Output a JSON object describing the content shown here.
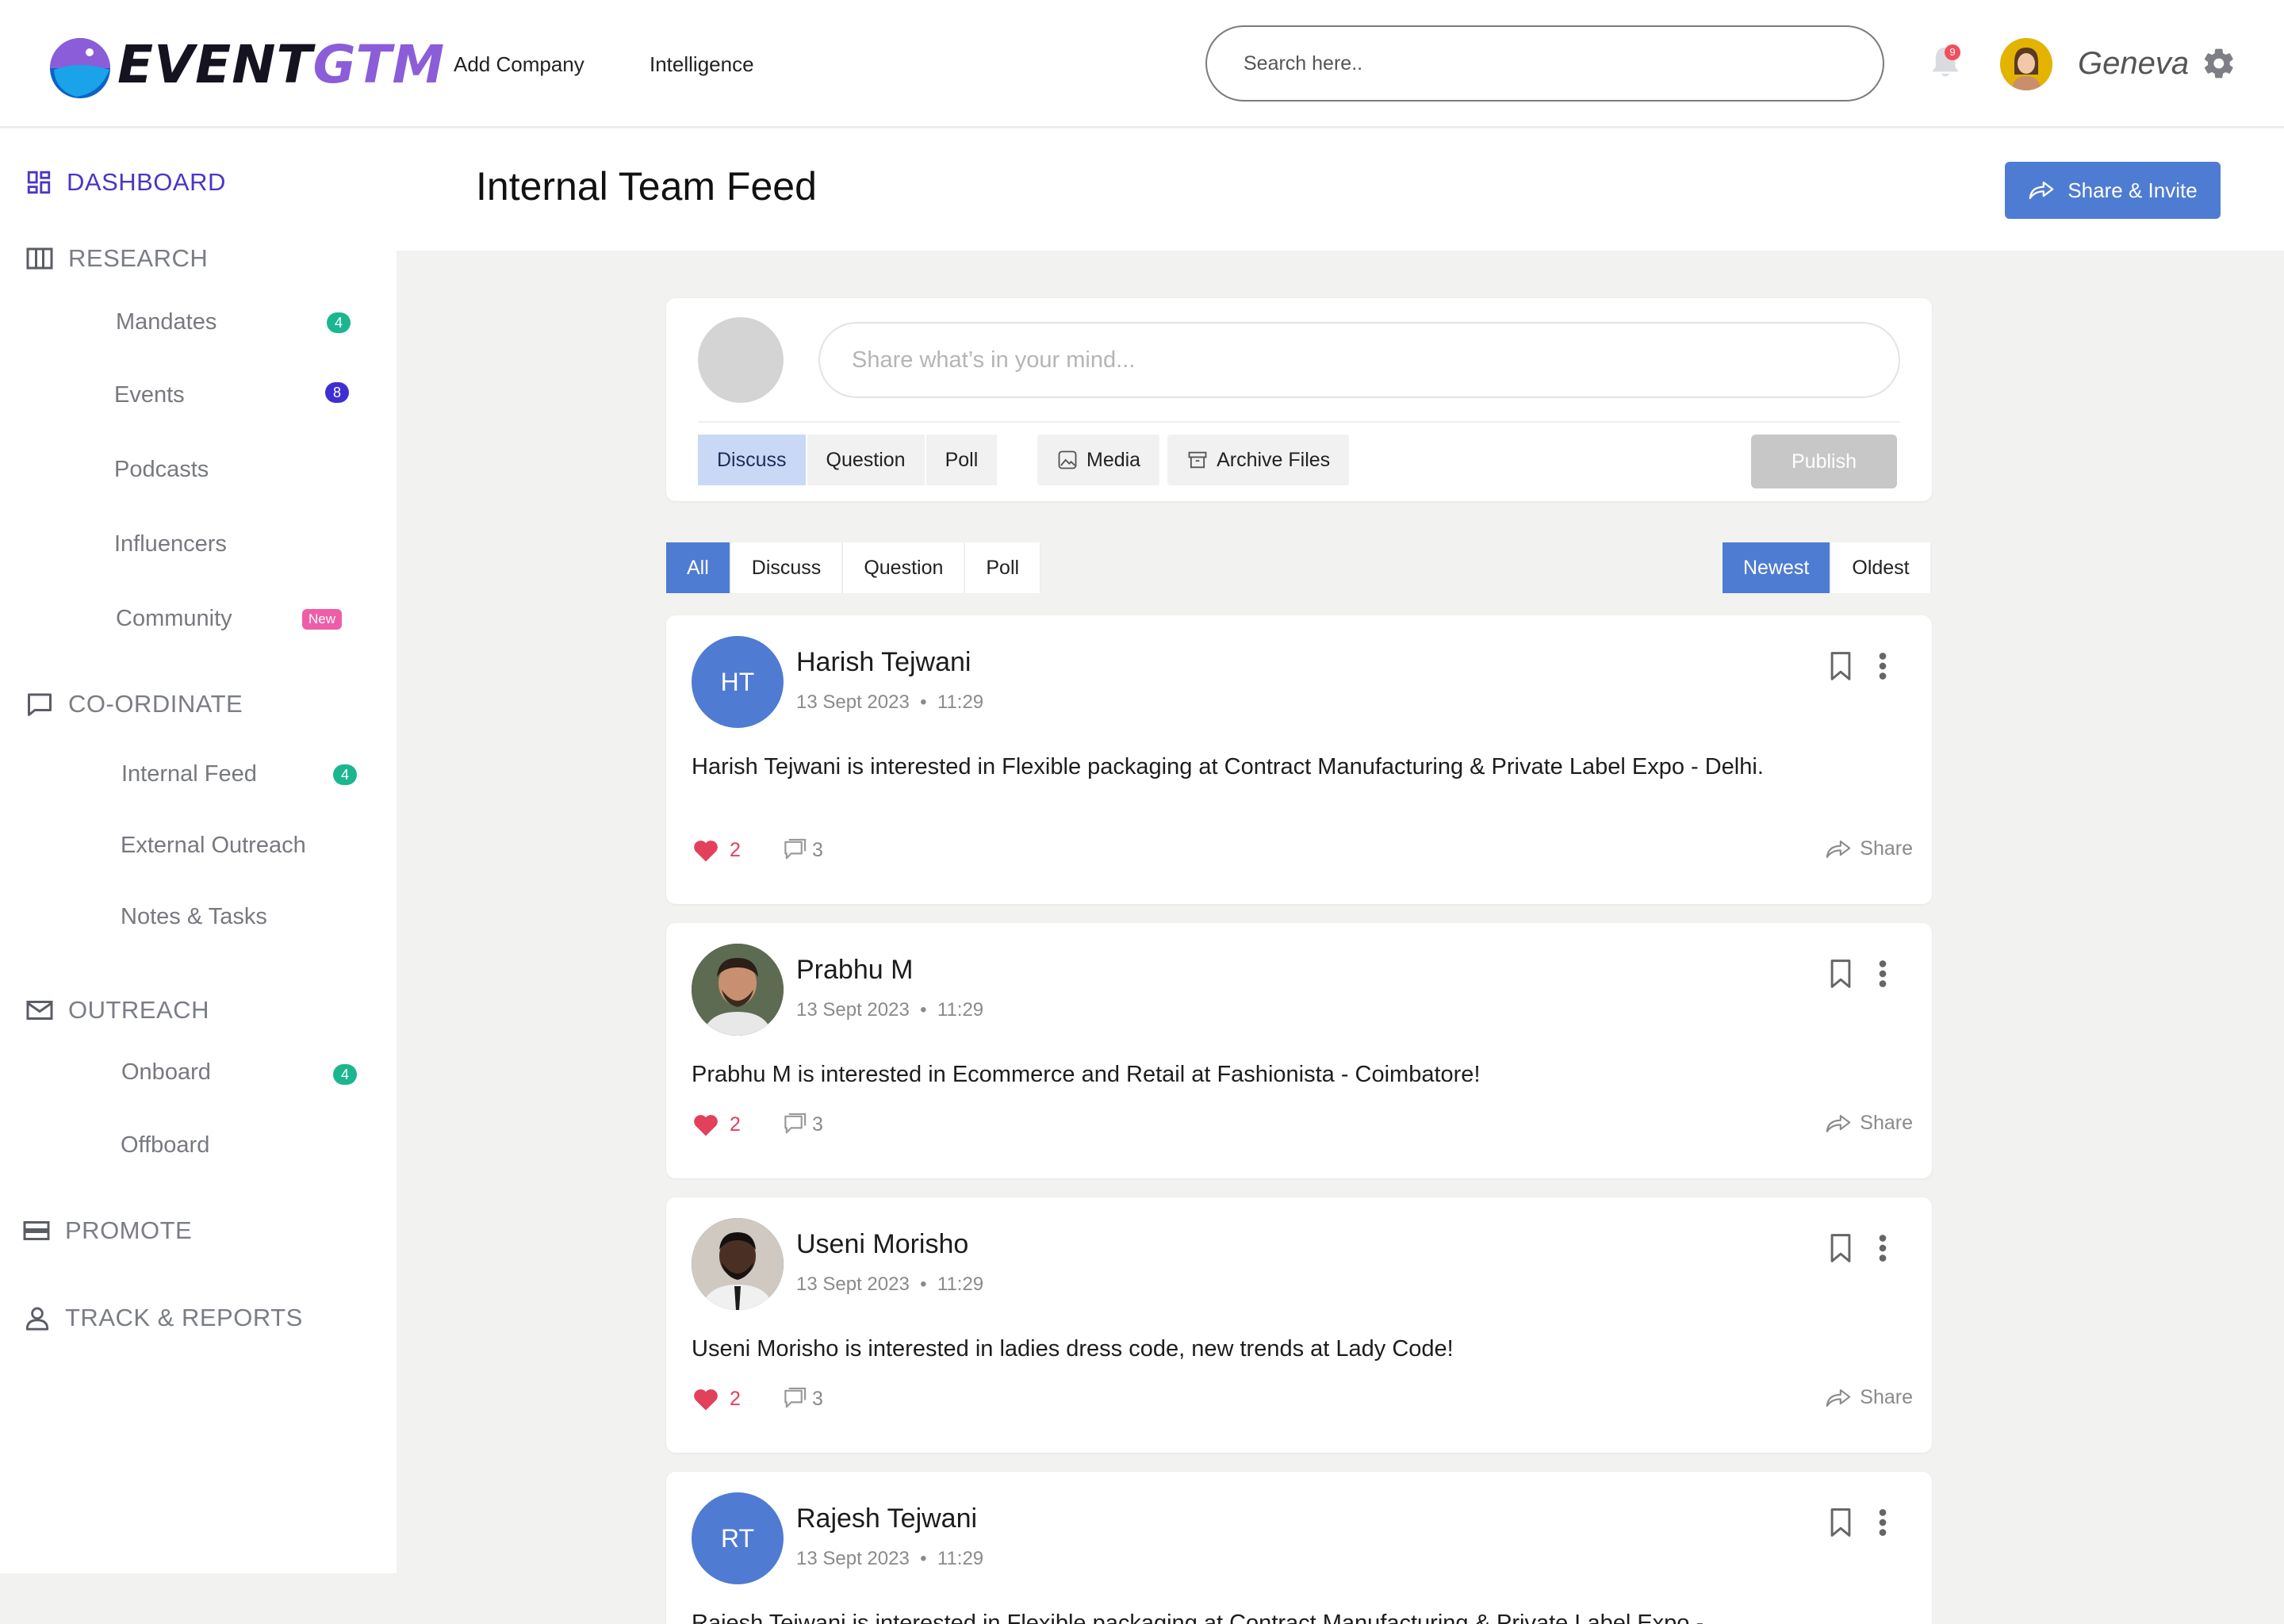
{
  "app": {
    "logo_text_a": "EVENT",
    "logo_text_b": "GTM",
    "brand_color": "#8b5dd8"
  },
  "topnav": {
    "items": [
      {
        "label": "Add Company"
      },
      {
        "label": "Intelligence"
      }
    ]
  },
  "search": {
    "placeholder": "Search here.."
  },
  "notifications": {
    "count": "9"
  },
  "user": {
    "name": "Geneva"
  },
  "sidebar": {
    "sections": [
      {
        "label": "DASHBOARD",
        "icon": "dashboard-icon",
        "active": true
      },
      {
        "label": "RESEARCH",
        "icon": "columns-icon"
      },
      {
        "label": "CO-ORDINATE",
        "icon": "chat-icon"
      },
      {
        "label": "OUTREACH",
        "icon": "mail-icon"
      },
      {
        "label": "PROMOTE",
        "icon": "layers-icon"
      },
      {
        "label": "TRACK & REPORTS",
        "icon": "user-icon"
      }
    ],
    "items": [
      {
        "label": "Mandates",
        "badge": "4"
      },
      {
        "label": "Events",
        "badge": "8"
      },
      {
        "label": "Podcasts"
      },
      {
        "label": "Influencers"
      },
      {
        "label": "Community",
        "badge": "New"
      },
      {
        "label": "Internal Feed",
        "badge": "4"
      },
      {
        "label": "External Outreach"
      },
      {
        "label": "Notes & Tasks"
      },
      {
        "label": "Onboard",
        "badge": "4"
      },
      {
        "label": "Offboard"
      }
    ]
  },
  "page": {
    "title": "Internal Team Feed",
    "share_invite_label": "Share & Invite"
  },
  "composer": {
    "placeholder": "Share what’s in your mind...",
    "types": [
      {
        "label": "Discuss",
        "selected": true
      },
      {
        "label": "Question"
      },
      {
        "label": "Poll"
      }
    ],
    "attachments": [
      {
        "label": "Media",
        "icon": "image-icon"
      },
      {
        "label": "Archive Files",
        "icon": "archive-icon"
      }
    ],
    "publish_label": "Publish"
  },
  "filters": {
    "types": [
      {
        "label": "All",
        "selected": true
      },
      {
        "label": "Discuss"
      },
      {
        "label": "Question"
      },
      {
        "label": "Poll"
      }
    ],
    "sort": [
      {
        "label": "Newest",
        "selected": true
      },
      {
        "label": "Oldest"
      }
    ]
  },
  "posts": [
    {
      "initials": "HT",
      "name": "Harish Tejwani",
      "date": "13 Sept 2023",
      "time": "11:29",
      "text": "Harish Tejwani is interested in Flexible packaging at Contract Manufacturing & Private Label Expo - Delhi.",
      "likes": "2",
      "comments": "3",
      "share_label": "Share"
    },
    {
      "initials": "",
      "name": "Prabhu M",
      "date": "13 Sept 2023",
      "time": "11:29",
      "text": "Prabhu M is interested in Ecommerce and Retail at Fashionista - Coimbatore!",
      "likes": "2",
      "comments": "3",
      "share_label": "Share"
    },
    {
      "initials": "",
      "name": "Useni Morisho",
      "date": "13 Sept 2023",
      "time": "11:29",
      "text": "Useni Morisho is interested in ladies dress code, new trends at Lady Code!",
      "likes": "2",
      "comments": "3",
      "share_label": "Share"
    },
    {
      "initials": "RT",
      "name": "Rajesh Tejwani",
      "date": "13 Sept 2023",
      "time": "11:29",
      "text": "Rajesh Tejwani is interested in Flexible packaging at Contract Manufacturing & Private Label Expo -",
      "likes": "",
      "comments": "",
      "share_label": ""
    }
  ]
}
